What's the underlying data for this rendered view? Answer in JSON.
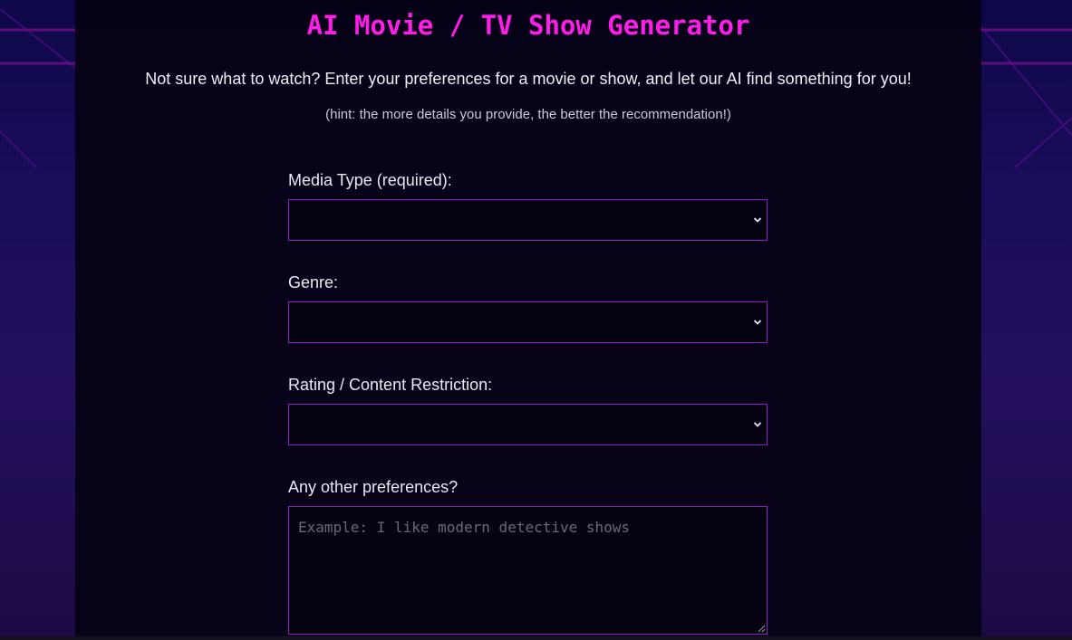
{
  "page": {
    "title": "AI Movie / TV Show Generator",
    "intro": "Not sure what to watch? Enter your preferences for a movie or show, and let our AI find something for you!",
    "hint": "(hint: the more details you provide, the better the recommendation!)"
  },
  "form": {
    "media_type": {
      "label": "Media Type (required):",
      "value": ""
    },
    "genre": {
      "label": "Genre:",
      "value": ""
    },
    "rating": {
      "label": "Rating / Content Restriction:",
      "value": ""
    },
    "preferences": {
      "label": "Any other preferences?",
      "value": "",
      "placeholder": "Example: I like modern detective shows"
    }
  },
  "icons": {
    "dropdown": "chevron-down-icon",
    "resize": "resize-grip-icon"
  },
  "colors": {
    "accent": "#ff1de8",
    "border": "#8b1fc2",
    "panel": "#050214",
    "background_top": "#0d0848",
    "background_bottom": "#24105e"
  }
}
